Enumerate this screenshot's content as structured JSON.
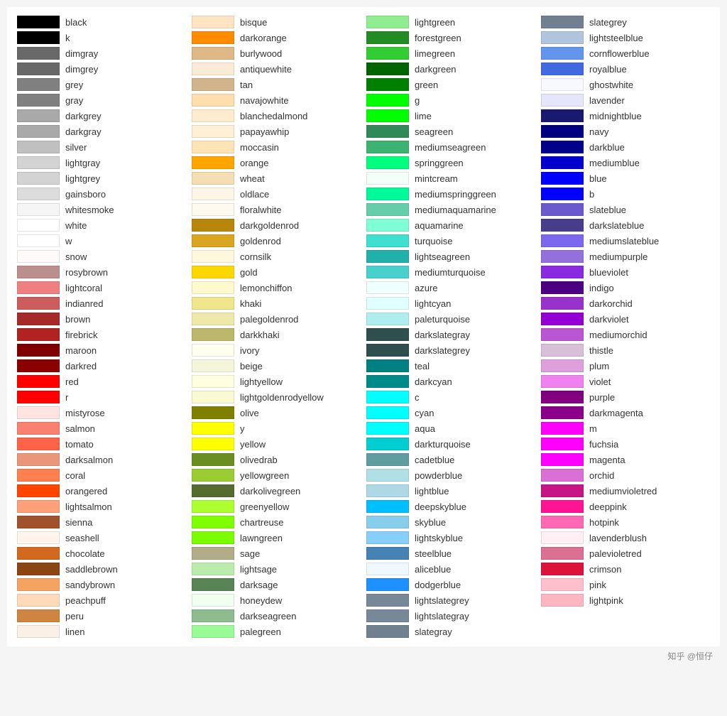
{
  "watermark": "知乎 @恒仔",
  "columns": [
    [
      {
        "name": "black",
        "color": "#000000"
      },
      {
        "name": "k",
        "color": "#000000"
      },
      {
        "name": "dimgray",
        "color": "#696969"
      },
      {
        "name": "dimgrey",
        "color": "#696969"
      },
      {
        "name": "grey",
        "color": "#808080"
      },
      {
        "name": "gray",
        "color": "#808080"
      },
      {
        "name": "darkgrey",
        "color": "#a9a9a9"
      },
      {
        "name": "darkgray",
        "color": "#a9a9a9"
      },
      {
        "name": "silver",
        "color": "#c0c0c0"
      },
      {
        "name": "lightgray",
        "color": "#d3d3d3"
      },
      {
        "name": "lightgrey",
        "color": "#d3d3d3"
      },
      {
        "name": "gainsboro",
        "color": "#dcdcdc"
      },
      {
        "name": "whitesmoke",
        "color": "#f5f5f5"
      },
      {
        "name": "white",
        "color": "#ffffff"
      },
      {
        "name": "w",
        "color": "#ffffff"
      },
      {
        "name": "snow",
        "color": "#fffafa"
      },
      {
        "name": "rosybrown",
        "color": "#bc8f8f"
      },
      {
        "name": "lightcoral",
        "color": "#f08080"
      },
      {
        "name": "indianred",
        "color": "#cd5c5c"
      },
      {
        "name": "brown",
        "color": "#a52a2a"
      },
      {
        "name": "firebrick",
        "color": "#b22222"
      },
      {
        "name": "maroon",
        "color": "#800000"
      },
      {
        "name": "darkred",
        "color": "#8b0000"
      },
      {
        "name": "red",
        "color": "#ff0000"
      },
      {
        "name": "r",
        "color": "#ff0000"
      },
      {
        "name": "mistyrose",
        "color": "#ffe4e1"
      },
      {
        "name": "salmon",
        "color": "#fa8072"
      },
      {
        "name": "tomato",
        "color": "#ff6347"
      },
      {
        "name": "darksalmon",
        "color": "#e9967a"
      },
      {
        "name": "coral",
        "color": "#ff7f50"
      },
      {
        "name": "orangered",
        "color": "#ff4500"
      },
      {
        "name": "lightsalmon",
        "color": "#ffa07a"
      },
      {
        "name": "sienna",
        "color": "#a0522d"
      },
      {
        "name": "seashell",
        "color": "#fff5ee"
      },
      {
        "name": "chocolate",
        "color": "#d2691e"
      },
      {
        "name": "saddlebrown",
        "color": "#8b4513"
      },
      {
        "name": "sandybrown",
        "color": "#f4a460"
      },
      {
        "name": "peachpuff",
        "color": "#ffdab9"
      },
      {
        "name": "peru",
        "color": "#cd853f"
      },
      {
        "name": "linen",
        "color": "#faf0e6"
      }
    ],
    [
      {
        "name": "bisque",
        "color": "#ffe4c4"
      },
      {
        "name": "darkorange",
        "color": "#ff8c00"
      },
      {
        "name": "burlywood",
        "color": "#deb887"
      },
      {
        "name": "antiquewhite",
        "color": "#faebd7"
      },
      {
        "name": "tan",
        "color": "#d2b48c"
      },
      {
        "name": "navajowhite",
        "color": "#ffdead"
      },
      {
        "name": "blanchedalmond",
        "color": "#ffebcd"
      },
      {
        "name": "papayawhip",
        "color": "#ffefd5"
      },
      {
        "name": "moccasin",
        "color": "#ffe4b5"
      },
      {
        "name": "orange",
        "color": "#ffa500"
      },
      {
        "name": "wheat",
        "color": "#f5deb3"
      },
      {
        "name": "oldlace",
        "color": "#fdf5e6"
      },
      {
        "name": "floralwhite",
        "color": "#fffaf0"
      },
      {
        "name": "darkgoldenrod",
        "color": "#b8860b"
      },
      {
        "name": "goldenrod",
        "color": "#daa520"
      },
      {
        "name": "cornsilk",
        "color": "#fff8dc"
      },
      {
        "name": "gold",
        "color": "#ffd700"
      },
      {
        "name": "lemonchiffon",
        "color": "#fffacd"
      },
      {
        "name": "khaki",
        "color": "#f0e68c"
      },
      {
        "name": "palegoldenrod",
        "color": "#eee8aa"
      },
      {
        "name": "darkkhaki",
        "color": "#bdb76b"
      },
      {
        "name": "ivory",
        "color": "#fffff0"
      },
      {
        "name": "beige",
        "color": "#f5f5dc"
      },
      {
        "name": "lightyellow",
        "color": "#ffffe0"
      },
      {
        "name": "lightgoldenrodyellow",
        "color": "#fafad2"
      },
      {
        "name": "olive",
        "color": "#808000"
      },
      {
        "name": "y",
        "color": "#ffff00"
      },
      {
        "name": "yellow",
        "color": "#ffff00"
      },
      {
        "name": "olivedrab",
        "color": "#6b8e23"
      },
      {
        "name": "yellowgreen",
        "color": "#9acd32"
      },
      {
        "name": "darkolivegreen",
        "color": "#556b2f"
      },
      {
        "name": "greenyellow",
        "color": "#adff2f"
      },
      {
        "name": "chartreuse",
        "color": "#7fff00"
      },
      {
        "name": "lawngreen",
        "color": "#7cfc00"
      },
      {
        "name": "sage",
        "color": "#b2ac88"
      },
      {
        "name": "lightsage",
        "color": "#bcecac"
      },
      {
        "name": "darksage",
        "color": "#598556"
      },
      {
        "name": "honeydew",
        "color": "#f0fff0"
      },
      {
        "name": "darkseagreen",
        "color": "#8fbc8f"
      },
      {
        "name": "palegreen",
        "color": "#98fb98"
      }
    ],
    [
      {
        "name": "lightgreen",
        "color": "#90ee90"
      },
      {
        "name": "forestgreen",
        "color": "#228b22"
      },
      {
        "name": "limegreen",
        "color": "#32cd32"
      },
      {
        "name": "darkgreen",
        "color": "#006400"
      },
      {
        "name": "green",
        "color": "#008000"
      },
      {
        "name": "g",
        "color": "#00ff00"
      },
      {
        "name": "lime",
        "color": "#00ff00"
      },
      {
        "name": "seagreen",
        "color": "#2e8b57"
      },
      {
        "name": "mediumseagreen",
        "color": "#3cb371"
      },
      {
        "name": "springgreen",
        "color": "#00ff7f"
      },
      {
        "name": "mintcream",
        "color": "#f5fffa"
      },
      {
        "name": "mediumspringgreen",
        "color": "#00fa9a"
      },
      {
        "name": "mediumaquamarine",
        "color": "#66cdaa"
      },
      {
        "name": "aquamarine",
        "color": "#7fffd4"
      },
      {
        "name": "turquoise",
        "color": "#40e0d0"
      },
      {
        "name": "lightseagreen",
        "color": "#20b2aa"
      },
      {
        "name": "mediumturquoise",
        "color": "#48d1cc"
      },
      {
        "name": "azure",
        "color": "#f0ffff"
      },
      {
        "name": "lightcyan",
        "color": "#e0ffff"
      },
      {
        "name": "paleturquoise",
        "color": "#afeeee"
      },
      {
        "name": "darkslategray",
        "color": "#2f4f4f"
      },
      {
        "name": "darkslategrey",
        "color": "#2f4f4f"
      },
      {
        "name": "teal",
        "color": "#008080"
      },
      {
        "name": "darkcyan",
        "color": "#008b8b"
      },
      {
        "name": "c",
        "color": "#00ffff"
      },
      {
        "name": "cyan",
        "color": "#00ffff"
      },
      {
        "name": "aqua",
        "color": "#00ffff"
      },
      {
        "name": "darkturquoise",
        "color": "#00ced1"
      },
      {
        "name": "cadetblue",
        "color": "#5f9ea0"
      },
      {
        "name": "powderblue",
        "color": "#b0e0e6"
      },
      {
        "name": "lightblue",
        "color": "#add8e6"
      },
      {
        "name": "deepskyblue",
        "color": "#00bfff"
      },
      {
        "name": "skyblue",
        "color": "#87ceeb"
      },
      {
        "name": "lightskyblue",
        "color": "#87cefa"
      },
      {
        "name": "steelblue",
        "color": "#4682b4"
      },
      {
        "name": "aliceblue",
        "color": "#f0f8ff"
      },
      {
        "name": "dodgerblue",
        "color": "#1e90ff"
      },
      {
        "name": "lightslategrey",
        "color": "#778899"
      },
      {
        "name": "lightslategray",
        "color": "#778899"
      },
      {
        "name": "slategray",
        "color": "#708090"
      }
    ],
    [
      {
        "name": "slategrey",
        "color": "#708090"
      },
      {
        "name": "lightsteelblue",
        "color": "#b0c4de"
      },
      {
        "name": "cornflowerblue",
        "color": "#6495ed"
      },
      {
        "name": "royalblue",
        "color": "#4169e1"
      },
      {
        "name": "ghostwhite",
        "color": "#f8f8ff"
      },
      {
        "name": "lavender",
        "color": "#e6e6fa"
      },
      {
        "name": "midnightblue",
        "color": "#191970"
      },
      {
        "name": "navy",
        "color": "#000080"
      },
      {
        "name": "darkblue",
        "color": "#00008b"
      },
      {
        "name": "mediumblue",
        "color": "#0000cd"
      },
      {
        "name": "blue",
        "color": "#0000ff"
      },
      {
        "name": "b",
        "color": "#0000ff"
      },
      {
        "name": "slateblue",
        "color": "#6a5acd"
      },
      {
        "name": "darkslateblue",
        "color": "#483d8b"
      },
      {
        "name": "mediumslateblue",
        "color": "#7b68ee"
      },
      {
        "name": "mediumpurple",
        "color": "#9370db"
      },
      {
        "name": "blueviolet",
        "color": "#8a2be2"
      },
      {
        "name": "indigo",
        "color": "#4b0082"
      },
      {
        "name": "darkorchid",
        "color": "#9932cc"
      },
      {
        "name": "darkviolet",
        "color": "#9400d3"
      },
      {
        "name": "mediumorchid",
        "color": "#ba55d3"
      },
      {
        "name": "thistle",
        "color": "#d8bfd8"
      },
      {
        "name": "plum",
        "color": "#dda0dd"
      },
      {
        "name": "violet",
        "color": "#ee82ee"
      },
      {
        "name": "purple",
        "color": "#800080"
      },
      {
        "name": "darkmagenta",
        "color": "#8b008b"
      },
      {
        "name": "m",
        "color": "#ff00ff"
      },
      {
        "name": "fuchsia",
        "color": "#ff00ff"
      },
      {
        "name": "magenta",
        "color": "#ff00ff"
      },
      {
        "name": "orchid",
        "color": "#da70d6"
      },
      {
        "name": "mediumvioletred",
        "color": "#c71585"
      },
      {
        "name": "deeppink",
        "color": "#ff1493"
      },
      {
        "name": "hotpink",
        "color": "#ff69b4"
      },
      {
        "name": "lavenderblush",
        "color": "#fff0f5"
      },
      {
        "name": "palevioletred",
        "color": "#db7093"
      },
      {
        "name": "crimson",
        "color": "#dc143c"
      },
      {
        "name": "pink",
        "color": "#ffc0cb"
      },
      {
        "name": "lightpink",
        "color": "#ffb6c1"
      }
    ]
  ]
}
